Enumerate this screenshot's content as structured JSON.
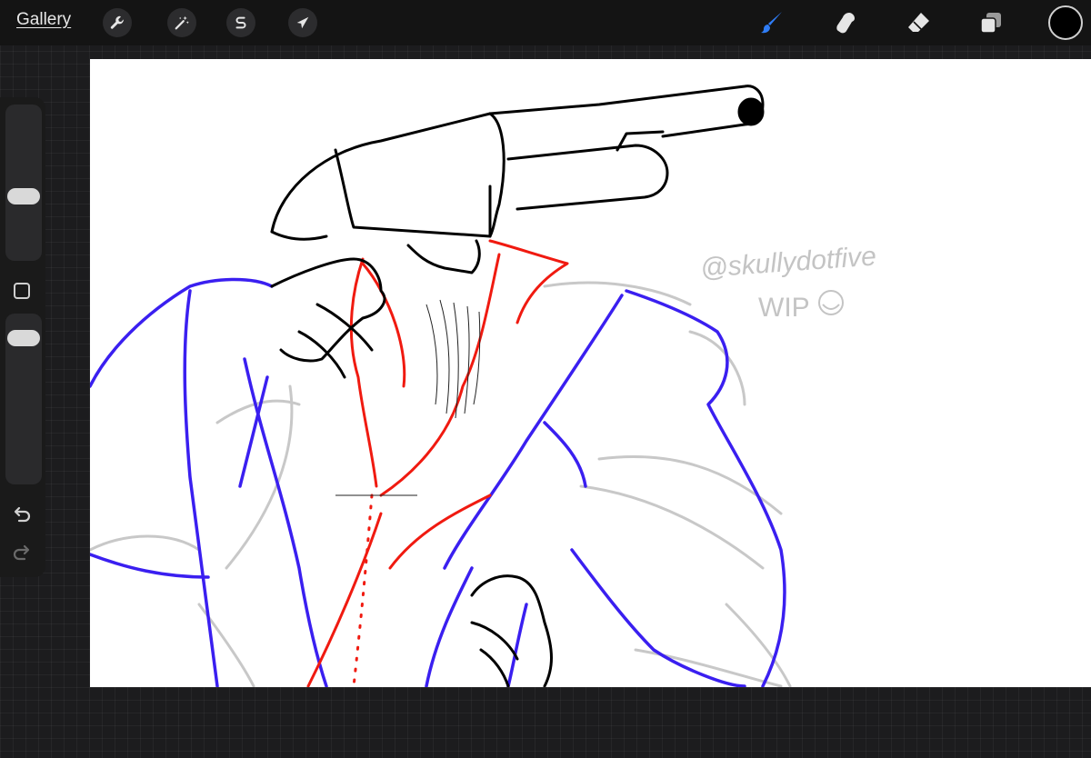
{
  "toolbar": {
    "gallery_label": "Gallery",
    "left_tools": [
      "wrench-icon",
      "magic-wand-icon",
      "selection-s-icon",
      "transform-arrow-icon"
    ],
    "right_tools": [
      "brush-icon",
      "smudge-icon",
      "eraser-icon",
      "layers-icon"
    ],
    "active_tool": "brush-icon",
    "active_color": "#000000",
    "accent_color": "#2f7df6"
  },
  "sidebar": {
    "brush_size_slider_level": 0.35,
    "opacity_slider_level": 0.55,
    "modify_button": "modify-square-icon",
    "undo": "undo-icon",
    "redo": "redo-icon"
  },
  "canvas": {
    "signature_text": "@skullydotfive",
    "wip_text": "WIP",
    "stroke_colors": {
      "ink": "#000000",
      "jacket": "#3a1ff0",
      "shirt": "#f01a10",
      "sketch": "#c8c8c8"
    }
  }
}
